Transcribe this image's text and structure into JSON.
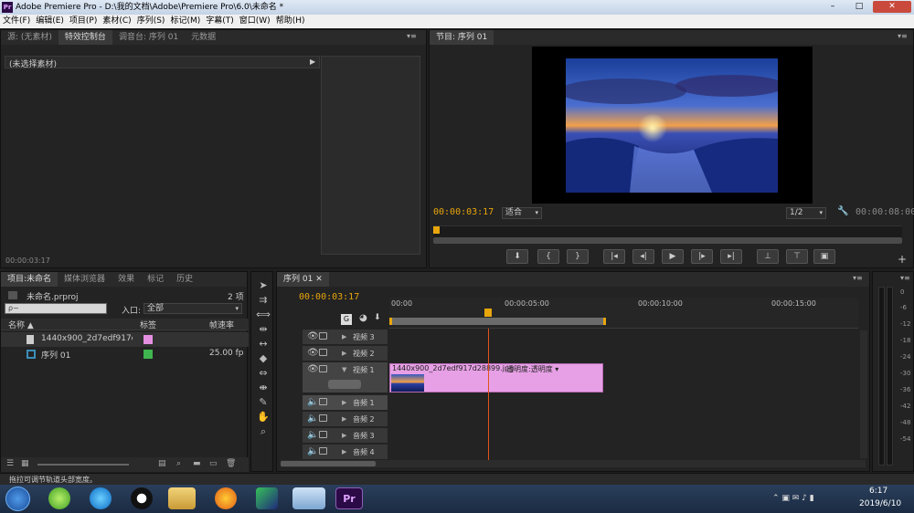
{
  "app": {
    "title": "Adobe Premiere Pro - D:\\我的文档\\Adobe\\Premiere Pro\\6.0\\未命名 *",
    "icon": "Pr"
  },
  "window_controls": {
    "minimize": "–",
    "maximize": "□",
    "close": "✕"
  },
  "menu": [
    "文件(F)",
    "编辑(E)",
    "项目(P)",
    "素材(C)",
    "序列(S)",
    "标记(M)",
    "字幕(T)",
    "窗口(W)",
    "帮助(H)"
  ],
  "effects_panel": {
    "tabs": [
      "源: (无素材)",
      "特效控制台",
      "调音台: 序列 01",
      "元数据"
    ],
    "active_tab": 1,
    "header_label": "(未选择素材)",
    "timecode": "00:00:03:17"
  },
  "program_monitor": {
    "tab": "节目: 序列 01",
    "timecode": "00:00:03:17",
    "fit_label": "适合",
    "resolution": "1/2",
    "duration": "00:00:08:00"
  },
  "project_panel": {
    "tabs": [
      "项目:未命名",
      "媒体浏览器",
      "效果",
      "标记",
      "历史"
    ],
    "project_file": "未命名.prproj",
    "item_count": "2 项",
    "search_placeholder": "ρ~",
    "inpoint_label": "入口:",
    "inpoint_value": "全部",
    "columns": {
      "name": "名称",
      "label": "标签",
      "framerate": "帧速率"
    },
    "items": [
      {
        "name": "1440x900_2d7edf917d28899",
        "color": "#e58fe0",
        "fps": ""
      },
      {
        "name": "序列 01",
        "color": "#3fb54f",
        "fps": "25.00 fp"
      }
    ]
  },
  "timeline": {
    "tab": "序列 01",
    "timecode": "00:00:03:17",
    "ruler": [
      "00:00",
      "00:00:05:00",
      "00:00:10:00",
      "00:00:15:00"
    ],
    "video_tracks": [
      "视频 3",
      "视频 2",
      "视频 1"
    ],
    "audio_tracks": [
      "音频 1",
      "音频 2",
      "音频 3",
      "音频 4"
    ],
    "clip_label": "1440x900_2d7edf917d28899.jpg",
    "clip_opacity": "透明度:透明度",
    "clip_color": "#e7a0e6"
  },
  "audio_meter": {
    "ticks": [
      "0",
      "-6",
      "-12",
      "-18",
      "-24",
      "-30",
      "-36",
      "-42",
      "-48",
      "-54"
    ]
  },
  "status_bar": {
    "text": "拖拉可调节轨道头部宽度。"
  },
  "taskbar": {
    "time": "6:17",
    "date": "2019/6/10"
  },
  "colors": {
    "accent": "#e8a60c",
    "panel": "#232323",
    "clip": "#e7a0e6",
    "playhead": "#e0531e"
  }
}
